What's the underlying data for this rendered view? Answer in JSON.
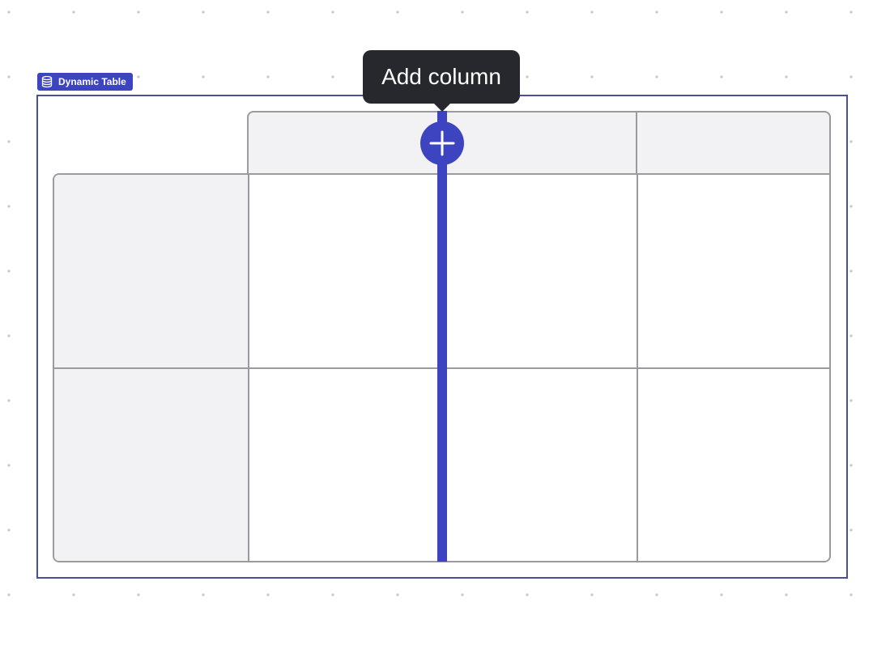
{
  "badge": {
    "label": "Dynamic Table",
    "icon": "database-icon"
  },
  "tooltip": {
    "text": "Add column"
  },
  "add_column_button": {
    "icon": "plus-icon"
  },
  "table": {
    "header_columns": 3,
    "body_rows": 2,
    "body_columns": 4,
    "cells": [
      [
        "",
        "",
        "",
        ""
      ],
      [
        "",
        "",
        "",
        ""
      ]
    ]
  },
  "colors": {
    "accent": "#3d44c0",
    "tooltip_bg": "#26282e",
    "header_fill": "#f2f2f4",
    "grid_line": "#9a9aa0",
    "selection_border": "#4b4f98",
    "canvas_dot": "#c4c4c8"
  }
}
